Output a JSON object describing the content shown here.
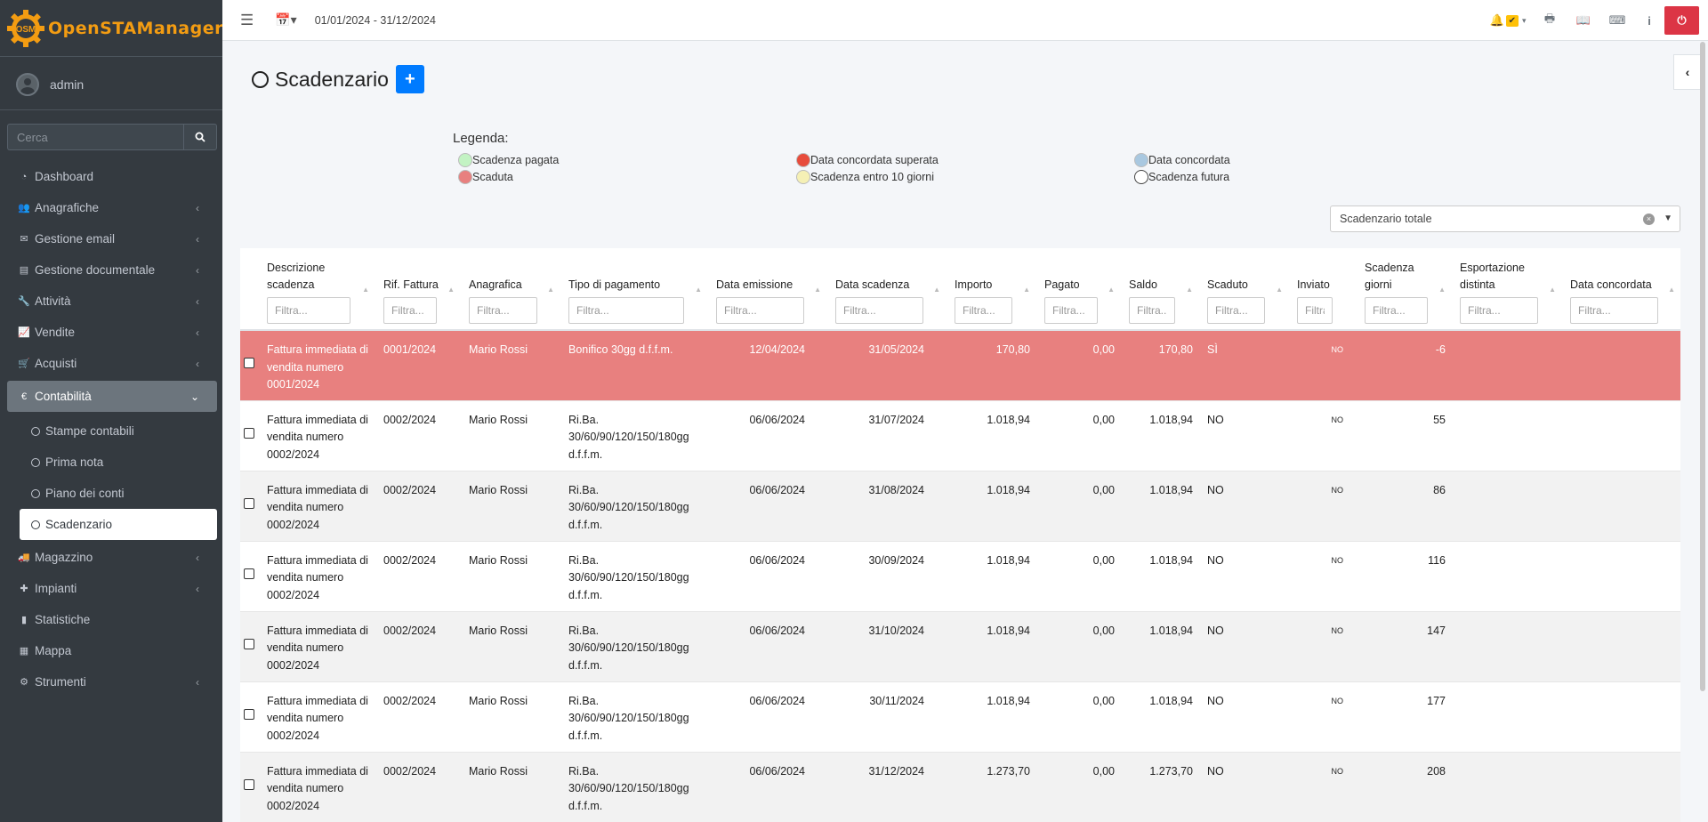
{
  "brand": {
    "logo_text": "OSM",
    "name": "OpenSTAManager"
  },
  "user": {
    "name": "admin"
  },
  "sidebar_search": {
    "placeholder": "Cerca"
  },
  "nav": [
    {
      "label": "Dashboard",
      "icon": "dashboard-icon"
    },
    {
      "label": "Anagrafiche",
      "icon": "users-icon",
      "has_children": true
    },
    {
      "label": "Gestione email",
      "icon": "envelope-icon",
      "has_children": true
    },
    {
      "label": "Gestione documentale",
      "icon": "file-icon",
      "has_children": true
    },
    {
      "label": "Attività",
      "icon": "wrench-icon",
      "has_children": true
    },
    {
      "label": "Vendite",
      "icon": "chart-line-icon",
      "has_children": true
    },
    {
      "label": "Acquisti",
      "icon": "cart-icon",
      "has_children": true
    },
    {
      "label": "Contabilità",
      "icon": "euro-icon",
      "has_children": true,
      "expanded": true
    },
    {
      "label": "Magazzino",
      "icon": "truck-icon",
      "has_children": true
    },
    {
      "label": "Impianti",
      "icon": "puzzle-icon",
      "has_children": true
    },
    {
      "label": "Statistiche",
      "icon": "bar-chart-icon"
    },
    {
      "label": "Mappa",
      "icon": "map-icon"
    },
    {
      "label": "Strumenti",
      "icon": "cog-icon",
      "has_children": true
    }
  ],
  "nav_sub": [
    {
      "label": "Stampe contabili"
    },
    {
      "label": "Prima nota"
    },
    {
      "label": "Piano dei conti"
    },
    {
      "label": "Scadenzario",
      "current": true
    }
  ],
  "topbar": {
    "date_range": "01/01/2024 - 31/12/2024"
  },
  "page": {
    "title": "Scadenzario",
    "add_label": "+"
  },
  "legend": {
    "title": "Legenda:",
    "items": [
      {
        "label": "Scadenza pagata",
        "color": "#c3f3c3"
      },
      {
        "label": "Data concordata superata",
        "color": "#e74c3c"
      },
      {
        "label": "Data concordata",
        "color": "#a9c8e0"
      },
      {
        "label": "Scaduta",
        "color": "#e8807f"
      },
      {
        "label": "Scadenza entro 10 giorni",
        "color": "#f5f0b5"
      },
      {
        "label": "Scadenza futura",
        "color": "#ffffff"
      }
    ]
  },
  "filter_select": {
    "value": "Scadenzario totale"
  },
  "table": {
    "filter_placeholder": "Filtra...",
    "columns": [
      {
        "label": "Descrizione scadenza"
      },
      {
        "label": "Rif. Fattura"
      },
      {
        "label": "Anagrafica"
      },
      {
        "label": "Tipo di pagamento"
      },
      {
        "label": "Data emissione"
      },
      {
        "label": "Data scadenza"
      },
      {
        "label": "Importo"
      },
      {
        "label": "Pagato"
      },
      {
        "label": "Saldo"
      },
      {
        "label": "Scaduto"
      },
      {
        "label": "Inviato"
      },
      {
        "label": "Scadenza giorni"
      },
      {
        "label": "Esportazione distinta"
      },
      {
        "label": "Data concordata"
      }
    ],
    "rows": [
      {
        "descr": "Fattura immediata di vendita numero 0001/2024",
        "rif": "0001/2024",
        "anag": "Mario Rossi",
        "tipo": "Bonifico 30gg d.f.f.m.",
        "emiss": "12/04/2024",
        "scad": "31/05/2024",
        "importo": "170,80",
        "pagato": "0,00",
        "saldo": "170,80",
        "scaduto": "SÌ",
        "inviato": "NO",
        "giorni": "-6",
        "overdue": true
      },
      {
        "descr": "Fattura immediata di vendita numero 0002/2024",
        "rif": "0002/2024",
        "anag": "Mario Rossi",
        "tipo": "Ri.Ba. 30/60/90/120/150/180gg d.f.f.m.",
        "emiss": "06/06/2024",
        "scad": "31/07/2024",
        "importo": "1.018,94",
        "pagato": "0,00",
        "saldo": "1.018,94",
        "scaduto": "NO",
        "inviato": "NO",
        "giorni": "55"
      },
      {
        "descr": "Fattura immediata di vendita numero 0002/2024",
        "rif": "0002/2024",
        "anag": "Mario Rossi",
        "tipo": "Ri.Ba. 30/60/90/120/150/180gg d.f.f.m.",
        "emiss": "06/06/2024",
        "scad": "31/08/2024",
        "importo": "1.018,94",
        "pagato": "0,00",
        "saldo": "1.018,94",
        "scaduto": "NO",
        "inviato": "NO",
        "giorni": "86"
      },
      {
        "descr": "Fattura immediata di vendita numero 0002/2024",
        "rif": "0002/2024",
        "anag": "Mario Rossi",
        "tipo": "Ri.Ba. 30/60/90/120/150/180gg d.f.f.m.",
        "emiss": "06/06/2024",
        "scad": "30/09/2024",
        "importo": "1.018,94",
        "pagato": "0,00",
        "saldo": "1.018,94",
        "scaduto": "NO",
        "inviato": "NO",
        "giorni": "116"
      },
      {
        "descr": "Fattura immediata di vendita numero 0002/2024",
        "rif": "0002/2024",
        "anag": "Mario Rossi",
        "tipo": "Ri.Ba. 30/60/90/120/150/180gg d.f.f.m.",
        "emiss": "06/06/2024",
        "scad": "31/10/2024",
        "importo": "1.018,94",
        "pagato": "0,00",
        "saldo": "1.018,94",
        "scaduto": "NO",
        "inviato": "NO",
        "giorni": "147"
      },
      {
        "descr": "Fattura immediata di vendita numero 0002/2024",
        "rif": "0002/2024",
        "anag": "Mario Rossi",
        "tipo": "Ri.Ba. 30/60/90/120/150/180gg d.f.f.m.",
        "emiss": "06/06/2024",
        "scad": "30/11/2024",
        "importo": "1.018,94",
        "pagato": "0,00",
        "saldo": "1.018,94",
        "scaduto": "NO",
        "inviato": "NO",
        "giorni": "177"
      },
      {
        "descr": "Fattura immediata di vendita numero 0002/2024",
        "rif": "0002/2024",
        "anag": "Mario Rossi",
        "tipo": "Ri.Ba. 30/60/90/120/150/180gg d.f.f.m.",
        "emiss": "06/06/2024",
        "scad": "31/12/2024",
        "importo": "1.273,70",
        "pagato": "0,00",
        "saldo": "1.273,70",
        "scaduto": "NO",
        "inviato": "NO",
        "giorni": "208"
      }
    ]
  }
}
